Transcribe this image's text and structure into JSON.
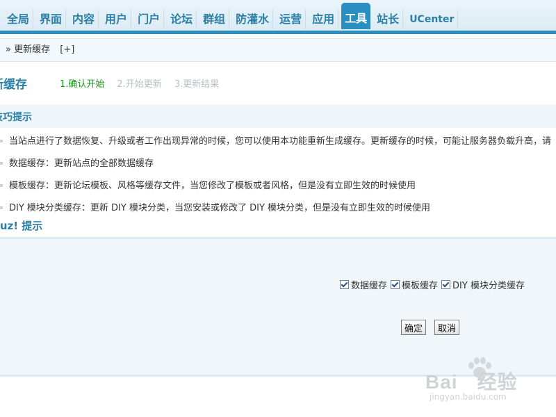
{
  "nav": {
    "tabs": [
      {
        "label": "全局"
      },
      {
        "label": "界面"
      },
      {
        "label": "内容"
      },
      {
        "label": "用户"
      },
      {
        "label": "门户"
      },
      {
        "label": "论坛"
      },
      {
        "label": "群组"
      },
      {
        "label": "防灌水"
      },
      {
        "label": "运营"
      },
      {
        "label": "应用"
      },
      {
        "label": "工具",
        "active": true
      },
      {
        "label": "站长"
      },
      {
        "label": "UCenter"
      }
    ],
    "accent": "#2b8ec0"
  },
  "breadcrumb": {
    "separator": "»",
    "current": "更新缓存",
    "add": "[+]"
  },
  "heading": {
    "title": "新缓存",
    "steps": [
      {
        "label": "1.确认开始",
        "state": "active"
      },
      {
        "label": "2.开始更新",
        "state": "pending"
      },
      {
        "label": "3.更新结果",
        "state": "pending"
      }
    ]
  },
  "tips": {
    "title": "技巧提示",
    "items": [
      "当站点进行了数据恢复、升级或者工作出现异常的时候，您可以使用本功能重新生成缓存。更新缓存的时候，可能让服务器负载升高，请",
      "数据缓存：更新站点的全部数据缓存",
      "模板缓存：更新论坛模板、风格等缓存文件，当您修改了模板或者风格，但是没有立即生效的时候使用",
      "DIY 模块分类缓存：更新 DIY 模块分类，当您安装或修改了 DIY 模块分类，但是没有立即生效的时候使用"
    ]
  },
  "prompt": {
    "title": "scuz! 提示"
  },
  "form": {
    "checkboxes": [
      {
        "label": "数据缓存",
        "checked": true
      },
      {
        "label": "模板缓存",
        "checked": true
      },
      {
        "label": "DIY 模块分类缓存",
        "checked": true
      }
    ],
    "confirm_label": "确定",
    "cancel_label": "取消"
  },
  "watermark": {
    "logo": "Bai 经验",
    "url": "jingyan.baidu.com"
  }
}
